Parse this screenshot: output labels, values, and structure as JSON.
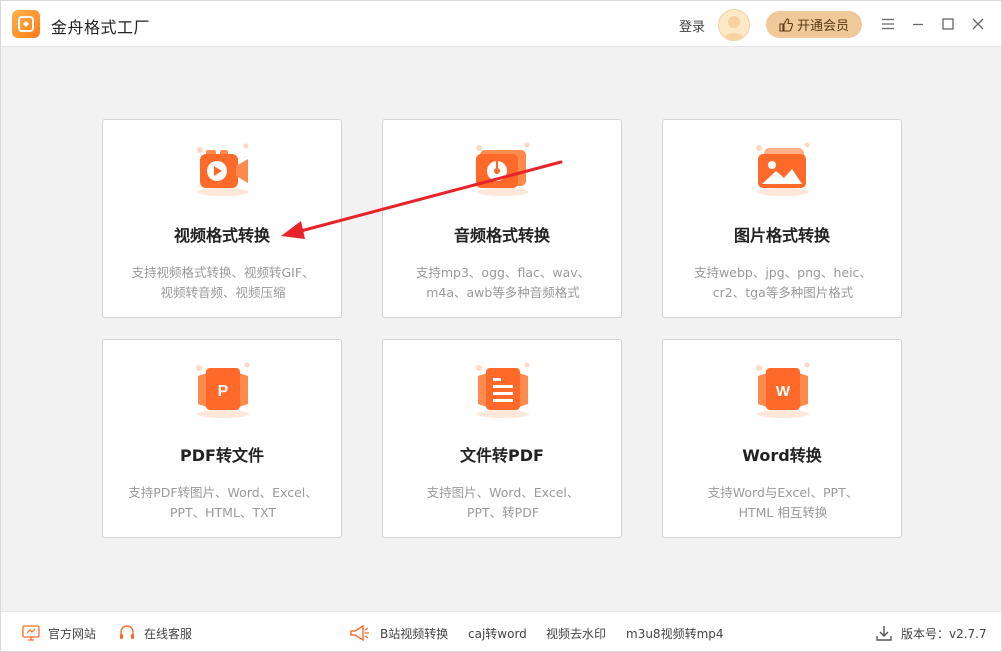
{
  "app": {
    "title": "金舟格式工厂",
    "login": "登录",
    "vip_button": "开通会员"
  },
  "cards": [
    {
      "title": "视频格式转换",
      "desc": [
        "支持视频格式转换、视频转GIF、",
        "视频转音频、视频压缩"
      ],
      "icon": "video-icon"
    },
    {
      "title": "音频格式转换",
      "desc": [
        "支持mp3、ogg、flac、wav、",
        "m4a、awb等多种音频格式"
      ],
      "icon": "audio-icon"
    },
    {
      "title": "图片格式转换",
      "desc": [
        "支持webp、jpg、png、heic、",
        "cr2、tga等多种图片格式"
      ],
      "icon": "image-icon"
    },
    {
      "title": "PDF转文件",
      "desc": [
        "支持PDF转图片、Word、Excel、",
        "PPT、HTML、TXT"
      ],
      "icon": "pdf-icon",
      "icon_letter": "P"
    },
    {
      "title": "文件转PDF",
      "desc": [
        "支持图片、Word、Excel、",
        "PPT、转PDF"
      ],
      "icon": "document-icon"
    },
    {
      "title": "Word转换",
      "desc": [
        "支持Word与Excel、PPT、",
        "HTML 相互转换"
      ],
      "icon": "word-icon",
      "icon_letter": "W"
    }
  ],
  "bottom": {
    "official_site": "官方网站",
    "online_support": "在线客服",
    "links": [
      "B站视频转换",
      "caj转word",
      "视频去水印",
      "m3u8视频转mp4"
    ],
    "version": "版本号：v2.7.7"
  },
  "colors": {
    "accent": "#ff6a2b",
    "vip": "#efc99a",
    "annotation_arrow": "#e8242a"
  }
}
